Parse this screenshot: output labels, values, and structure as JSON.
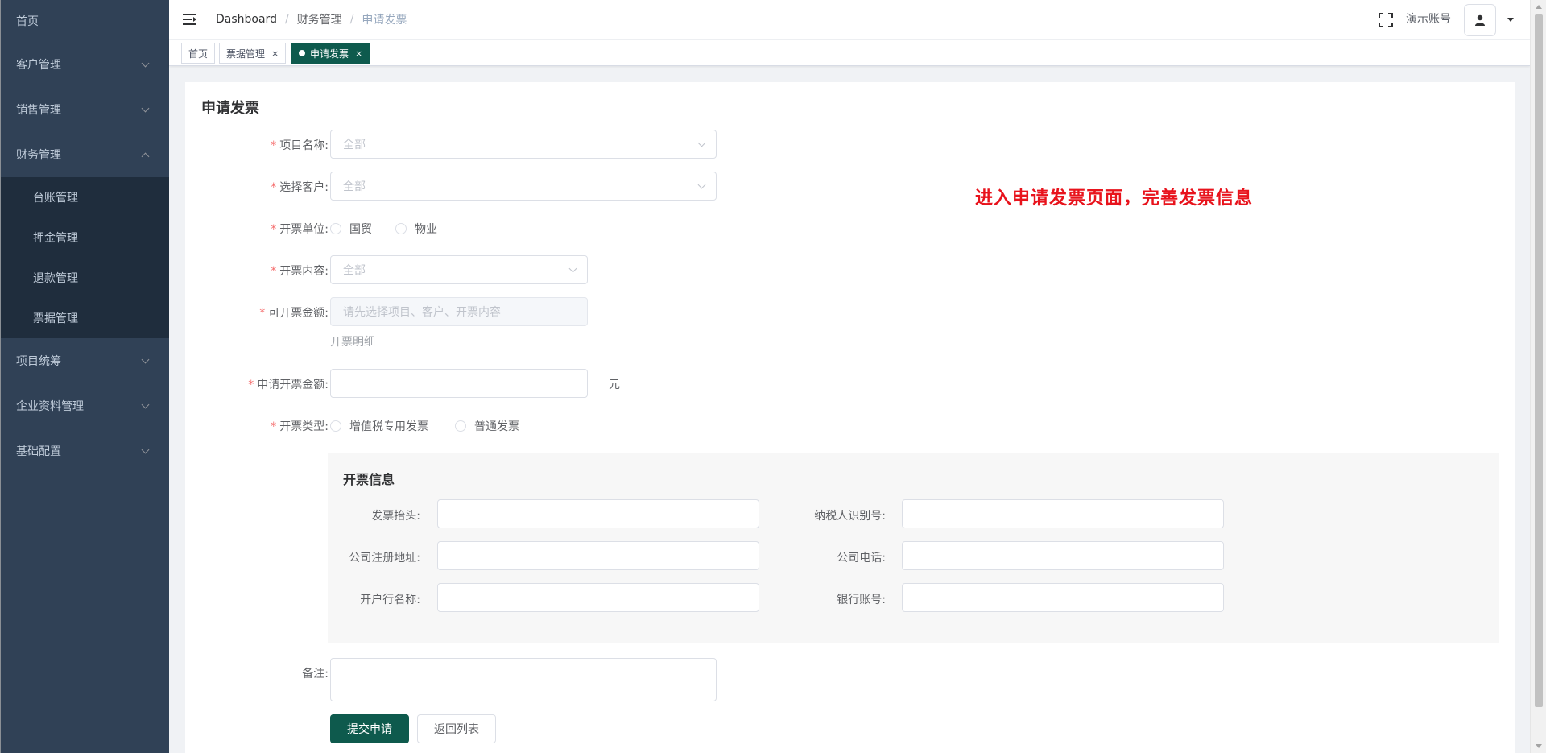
{
  "sidebar": {
    "items": [
      {
        "label": "首页"
      },
      {
        "label": "客户管理"
      },
      {
        "label": "销售管理"
      },
      {
        "label": "财务管理"
      },
      {
        "label": "项目统筹"
      },
      {
        "label": "企业资料管理"
      },
      {
        "label": "基础配置"
      }
    ],
    "finance_sub": [
      {
        "label": "台账管理"
      },
      {
        "label": "押金管理"
      },
      {
        "label": "退款管理"
      },
      {
        "label": "票据管理"
      }
    ]
  },
  "navbar": {
    "breadcrumb": [
      "Dashboard",
      "财务管理",
      "申请发票"
    ],
    "account": "演示账号"
  },
  "tags": [
    {
      "label": "首页"
    },
    {
      "label": "票据管理",
      "close": "×"
    },
    {
      "label": "申请发票",
      "close": "×"
    }
  ],
  "form": {
    "title": "申请发票",
    "required_mark": "*",
    "project_label": "项目名称:",
    "project_placeholder": "全部",
    "customer_label": "选择客户:",
    "customer_placeholder": "全部",
    "unit_label": "开票单位:",
    "unit_options": [
      "国贸",
      "物业"
    ],
    "content_label": "开票内容:",
    "content_placeholder": "全部",
    "available_label": "可开票金额:",
    "available_placeholder": "请先选择项目、客户、开票内容",
    "detail_link": "开票明细",
    "apply_label": "申请开票金额:",
    "apply_unit": "元",
    "type_label": "开票类型:",
    "type_options": [
      "增值税专用发票",
      "普通发票"
    ],
    "remark_label": "备注:",
    "submit": "提交申请",
    "back": "返回列表"
  },
  "invoice_info": {
    "title": "开票信息",
    "header_label": "发票抬头:",
    "taxno_label": "纳税人识别号:",
    "address_label": "公司注册地址:",
    "phone_label": "公司电话:",
    "bank_label": "开户行名称:",
    "account_label": "银行账号:"
  },
  "annotation": "进入申请发票页面，完善发票信息",
  "colors": {
    "sidebar_bg": "#304156",
    "submenu_bg": "#1f2d3d",
    "primary": "#0e5a4d",
    "required": "#f56c6c",
    "annotation": "#e8131c"
  }
}
